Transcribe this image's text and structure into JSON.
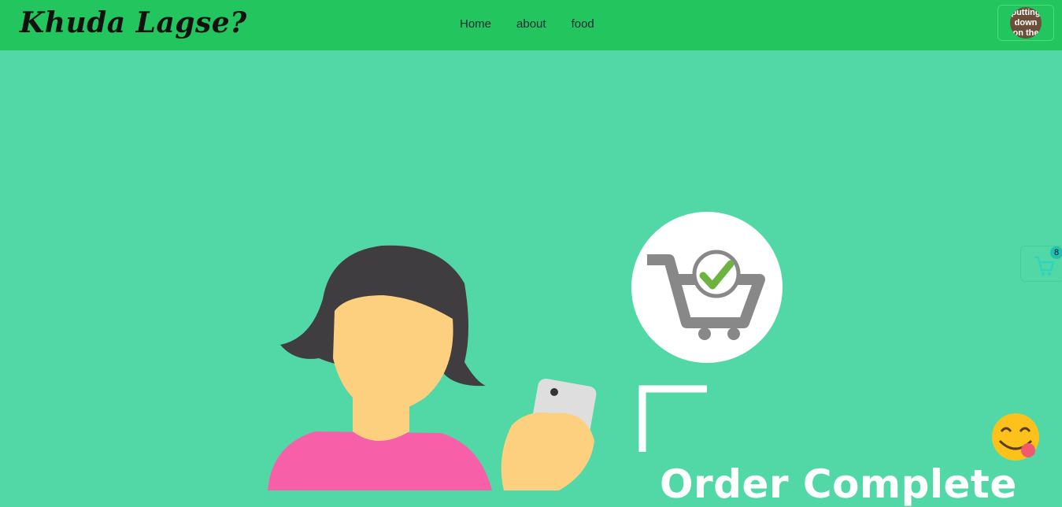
{
  "navbar": {
    "brand": "Khuda Lagse?",
    "links": [
      {
        "label": "Home"
      },
      {
        "label": "about"
      },
      {
        "label": "food"
      }
    ],
    "avatar_text": "putting down on the"
  },
  "cart": {
    "count": "8",
    "icon": "shopping-cart-icon"
  },
  "hero": {
    "order_text": "Order Complete",
    "emoji": "😋",
    "badge_icon": "cart-check-icon"
  },
  "colors": {
    "navbar": "#22c55e",
    "background": "#52d8a6",
    "hair": "#3f3d40",
    "skin": "#fdd07f",
    "shirt": "#f760a8",
    "check": "#6db33f"
  }
}
